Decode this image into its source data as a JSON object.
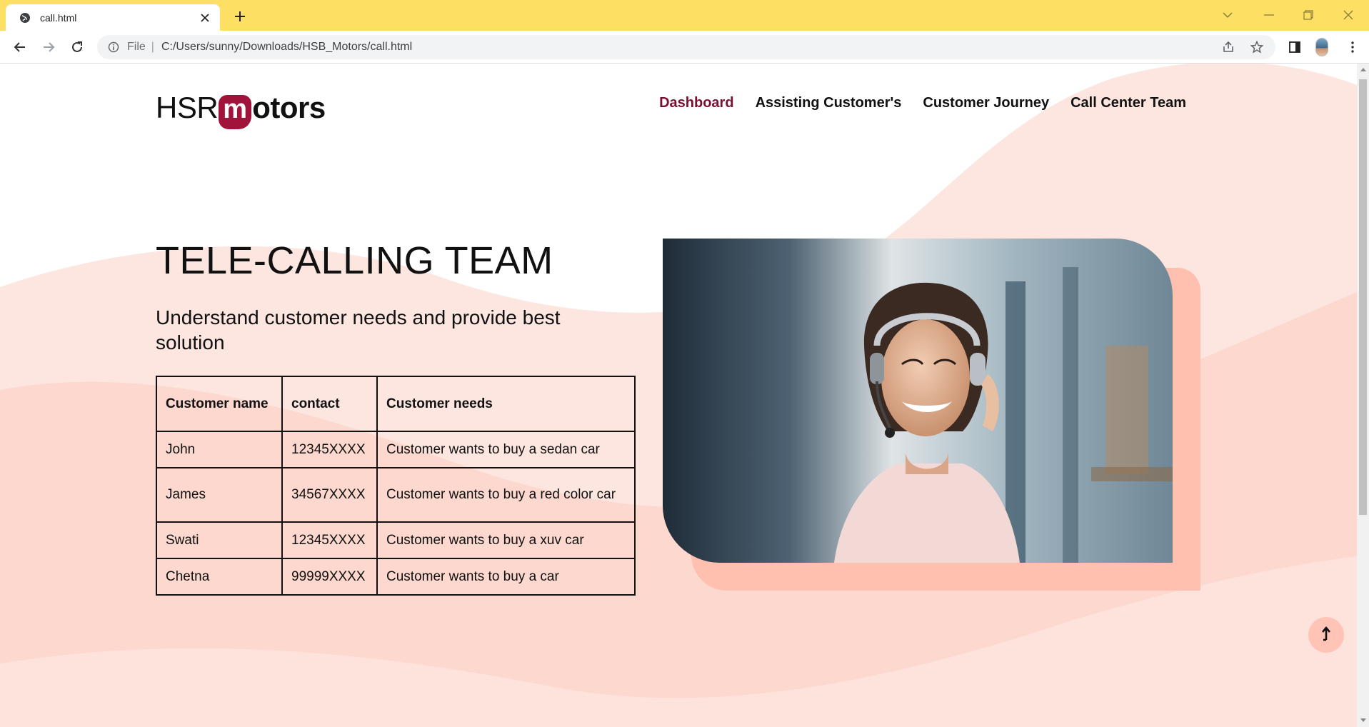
{
  "browser": {
    "tab_title": "call.html",
    "omnibox_scheme": "File",
    "url": "C:/Users/sunny/Downloads/HSB_Motors/call.html"
  },
  "logo": {
    "part1": "HSR",
    "m": "m",
    "part2": "otors"
  },
  "nav": {
    "items": [
      "Dashboard",
      "Assisting Customer's",
      "Customer Journey",
      "Call Center Team"
    ],
    "active": "Dashboard"
  },
  "hero": {
    "title": "TELE-CALLING TEAM",
    "subtitle": "Understand customer needs and provide best solution"
  },
  "table": {
    "headers": [
      "Customer name",
      "contact",
      "Customer needs"
    ],
    "rows": [
      [
        "John",
        "12345XXXX",
        "Customer wants to buy a sedan car"
      ],
      [
        "James",
        "34567XXXX",
        "Customer wants to buy a red color car"
      ],
      [
        "Swati",
        "12345XXXX",
        "Customer wants to buy a xuv car"
      ],
      [
        "Chetna",
        "99999XXXX",
        "Customer wants to buy a car"
      ]
    ]
  },
  "colors": {
    "tabstrip": "#fcdf63",
    "brand": "#a0143b",
    "nav_active": "#7a1030",
    "backdrop": "#ffc0b0",
    "wave_light": "#fde3dc",
    "wave_mid": "#fbd3c9"
  },
  "icons": {
    "tab": "globe-icon",
    "back_to_top": "arrow-up-icon"
  }
}
